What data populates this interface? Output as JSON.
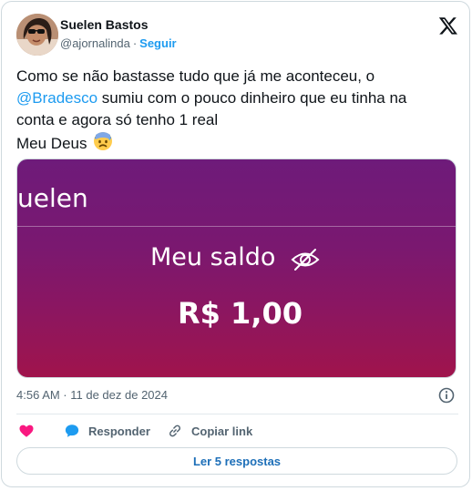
{
  "author": {
    "name": "Suelen Bastos",
    "handle": "@ajornalinda",
    "separator": "·",
    "follow_label": "Seguir"
  },
  "tweet": {
    "line1": "Como se não bastasse tudo que já me aconteceu, o",
    "mention": "@Bradesco",
    "line2_rest": " sumiu com o pouco dinheiro que eu tinha na",
    "line3": "conta e agora só tenho 1 real",
    "line4": "Meu Deus",
    "emoji": "anxious-face-with-sweat"
  },
  "media": {
    "name_fragment": "uelen",
    "balance_label": "Meu saldo",
    "balance_value": "R$ 1,00",
    "icon": "eye-off-icon"
  },
  "meta": {
    "timestamp": "4:56 AM · 11 de dez de 2024"
  },
  "actions": {
    "reply_label": "Responder",
    "copy_link_label": "Copiar link"
  },
  "footer": {
    "read_replies_label": "Ler 5 respostas"
  },
  "colors": {
    "accent": "#1d9bf0",
    "like": "#f91880",
    "reply_icon": "#1d9bf0",
    "media_top": "#6e1b7a",
    "media_bottom": "#a0144c"
  }
}
